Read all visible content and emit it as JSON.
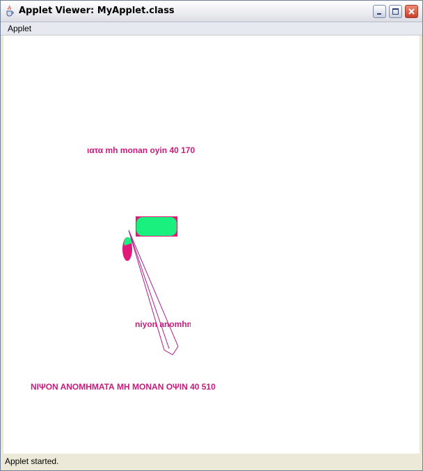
{
  "window": {
    "title": "Applet Viewer: MyApplet.class",
    "controls": [
      "minimize",
      "maximize",
      "close"
    ]
  },
  "menubar": {
    "items": [
      "Applet"
    ]
  },
  "canvas": {
    "texts": [
      "ιατα mh monan oyin 40 170",
      "niyon anomhm",
      "ΝΙΨΟΝ ΑΝΟΜΗΜΑΤΑ ΜΗ ΜΟΝΑΝ ΟΨΙΝ 40 510"
    ],
    "colors": {
      "text": "#c81b7c",
      "shape_fill": "#1af07e",
      "shape_outline": "#e0187a",
      "line": "#b01a8c"
    }
  },
  "status": {
    "text": "Applet started."
  }
}
